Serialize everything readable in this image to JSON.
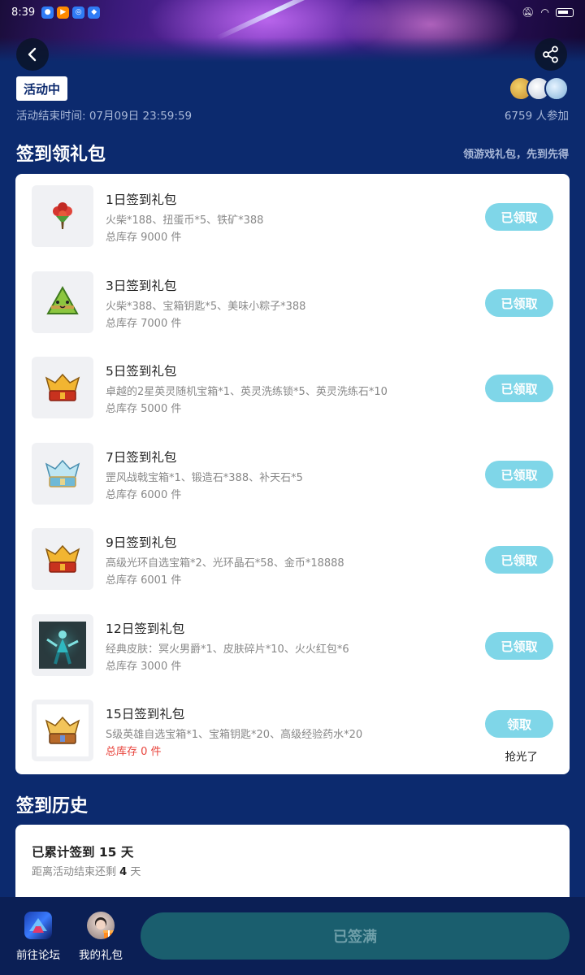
{
  "status_bar": {
    "time": "8:39"
  },
  "header": {
    "status_badge": "活动中",
    "end_time": "活动结束时间: 07月09日 23:59:59",
    "participants": "6759 人参加"
  },
  "gift_section": {
    "title": "签到领礼包",
    "subtitle": "领游戏礼包，先到先得",
    "items": [
      {
        "name": "1日签到礼包",
        "desc": "火柴*188、扭蛋币*5、铁矿*388",
        "stock": "总库存 9000 件",
        "button": "已领取",
        "icon": "bouquet-icon"
      },
      {
        "name": "3日签到礼包",
        "desc": "火柴*388、宝箱钥匙*5、美味小粽子*388",
        "stock": "总库存 7000 件",
        "button": "已领取",
        "icon": "zongzi-icon"
      },
      {
        "name": "5日签到礼包",
        "desc": "卓越的2星英灵随机宝箱*1、英灵洗练锁*5、英灵洗练石*10",
        "stock": "总库存 5000 件",
        "button": "已领取",
        "icon": "red-chest-icon"
      },
      {
        "name": "7日签到礼包",
        "desc": "罡风战戟宝箱*1、锻造石*388、补天石*5",
        "stock": "总库存 6000 件",
        "button": "已领取",
        "icon": "blue-chest-icon"
      },
      {
        "name": "9日签到礼包",
        "desc": "高级光环自选宝箱*2、光环晶石*58、金币*18888",
        "stock": "总库存 6001 件",
        "button": "已领取",
        "icon": "red-chest-icon"
      },
      {
        "name": "12日签到礼包",
        "desc": "经典皮肤：冥火男爵*1、皮肤碎片*10、火火红包*6",
        "stock": "总库存 3000 件",
        "button": "已领取",
        "icon": "skin-portrait-icon"
      },
      {
        "name": "15日签到礼包",
        "desc": "S级英雄自选宝箱*1、宝箱钥匙*20、高级经验药水*20",
        "stock": "总库存 0 件",
        "button": "领取",
        "sold_out": "抢光了",
        "icon": "gold-chest-icon"
      }
    ]
  },
  "history_section": {
    "title": "签到历史",
    "total_label": "已累计签到 15 天",
    "remaining_prefix": "距离活动结束还剩 ",
    "remaining_days": "4",
    "remaining_suffix": " 天"
  },
  "bottom_bar": {
    "forum_label": "前往论坛",
    "gifts_label": "我的礼包",
    "signed_button": "已签满"
  },
  "colors": {
    "background": "#0c2a6e",
    "claimed_button": "#7fd6e8",
    "out_of_stock": "#e8423a"
  }
}
